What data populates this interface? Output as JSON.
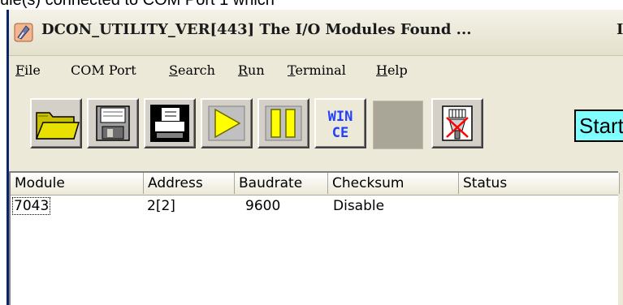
{
  "partial_text": "ule(s) connected to COM Port 1 which",
  "window": {
    "title": "DCON_UTILITY_VER[443] The I/O Modules Found ...",
    "title_cut": "I"
  },
  "menu": [
    {
      "key": "F",
      "rest": "ile"
    },
    {
      "key": "",
      "rest": "COM Port"
    },
    {
      "key": "S",
      "rest": "earch"
    },
    {
      "key": "R",
      "rest": "un"
    },
    {
      "key": "T",
      "rest": "erminal"
    },
    {
      "key": "H",
      "rest": "elp"
    }
  ],
  "toolbar": {
    "wince_top": "WIN",
    "wince_bottom": "CE",
    "status_text": "Start"
  },
  "list": {
    "columns": [
      "Module",
      "Address",
      "Baudrate",
      "Checksum",
      "Status"
    ],
    "rows": [
      {
        "module": "7043",
        "address": "2[2]",
        "baudrate": "9600",
        "checksum": "Disable",
        "status": ""
      }
    ]
  },
  "colors": {
    "status_bg": "#80ffff",
    "toolbar_face": "#d4d0c8",
    "window_face": "#ece9d8"
  }
}
